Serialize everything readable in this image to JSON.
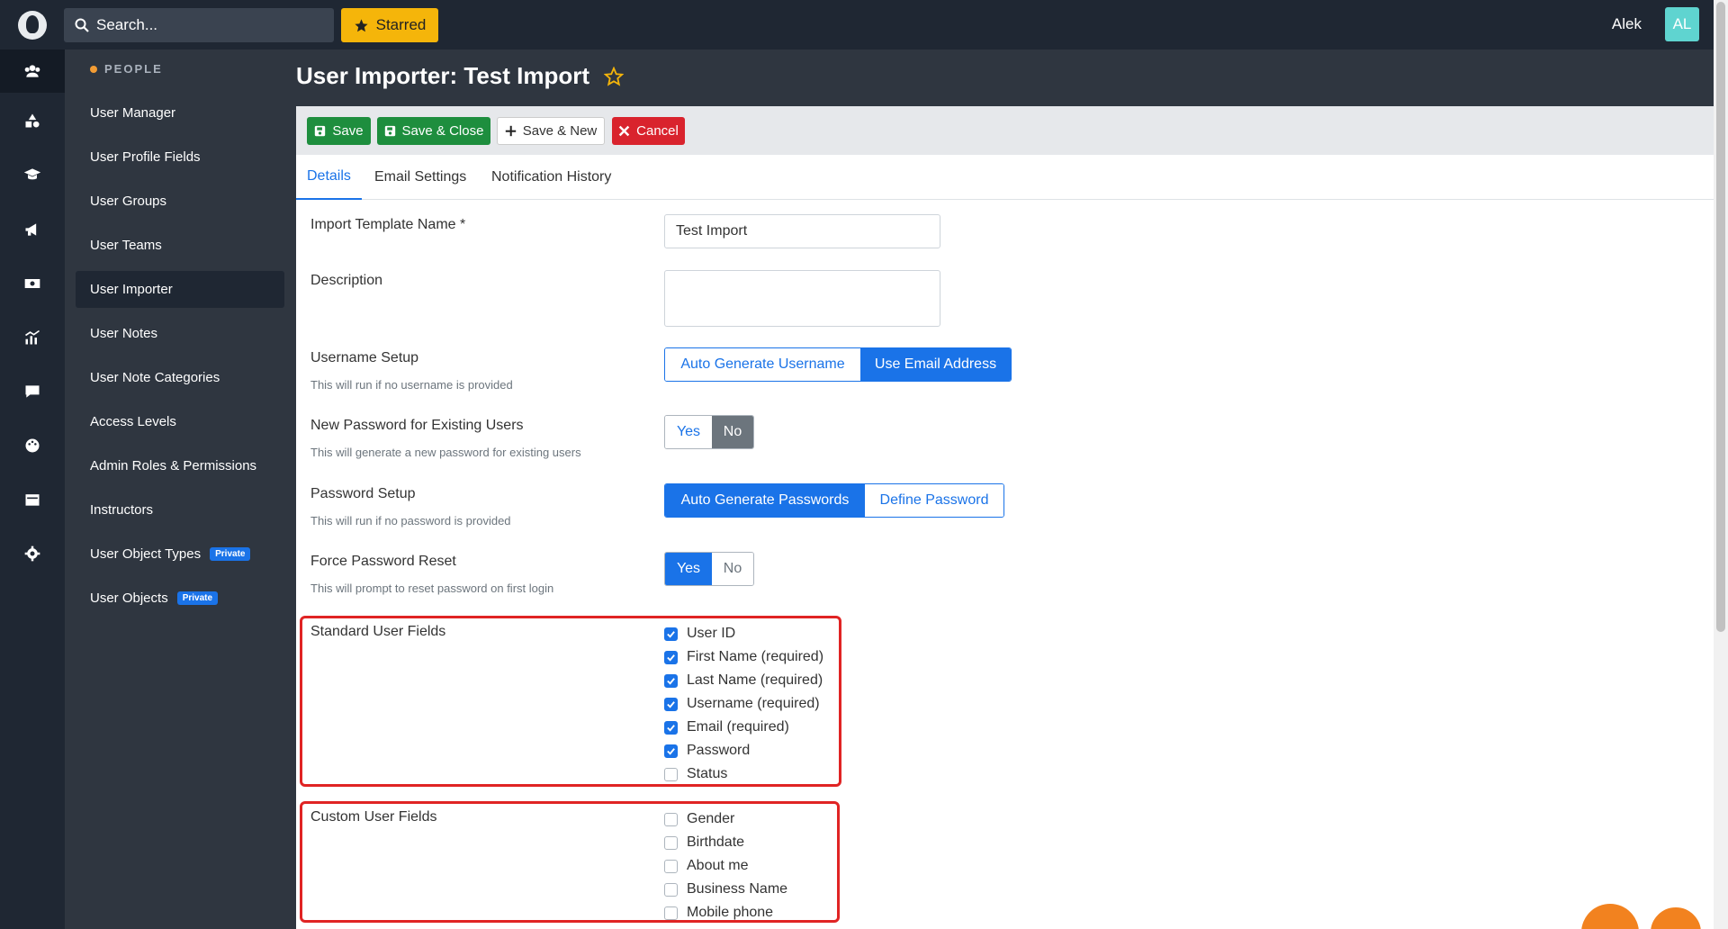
{
  "header": {
    "search_placeholder": "Search...",
    "starred_label": "Starred",
    "user_name": "Alek",
    "avatar_initials": "AL"
  },
  "sidebar": {
    "section": "PEOPLE",
    "items": [
      {
        "label": "User Manager"
      },
      {
        "label": "User Profile Fields"
      },
      {
        "label": "User Groups"
      },
      {
        "label": "User Teams"
      },
      {
        "label": "User Importer"
      },
      {
        "label": "User Notes"
      },
      {
        "label": "User Note Categories"
      },
      {
        "label": "Access Levels"
      },
      {
        "label": "Admin Roles & Permissions"
      },
      {
        "label": "Instructors"
      },
      {
        "label": "User Object Types",
        "badge": "Private"
      },
      {
        "label": "User Objects",
        "badge": "Private"
      }
    ]
  },
  "page": {
    "title": "User Importer: Test Import"
  },
  "toolbar": {
    "save": "Save",
    "save_close": "Save & Close",
    "save_new": "Save & New",
    "cancel": "Cancel"
  },
  "tabs": [
    "Details",
    "Email Settings",
    "Notification History"
  ],
  "form": {
    "template_name_label": "Import Template Name *",
    "template_name_value": "Test Import",
    "description_label": "Description",
    "username_setup_label": "Username Setup",
    "username_setup_help": "This will run if no username is provided",
    "username_options": [
      "Auto Generate Username",
      "Use Email Address"
    ],
    "new_password_label": "New Password for Existing Users",
    "new_password_help": "This will generate a new password for existing users",
    "new_password_options": [
      "Yes",
      "No"
    ],
    "password_setup_label": "Password Setup",
    "password_setup_help": "This will run if no password is provided",
    "password_setup_options": [
      "Auto Generate Passwords",
      "Define Password"
    ],
    "force_reset_label": "Force Password Reset",
    "force_reset_help": "This will prompt to reset password on first login",
    "force_reset_options": [
      "Yes",
      "No"
    ],
    "standard_fields_label": "Standard User Fields",
    "standard_fields": [
      {
        "label": "User ID",
        "checked": true
      },
      {
        "label": "First Name (required)",
        "checked": true
      },
      {
        "label": "Last Name (required)",
        "checked": true
      },
      {
        "label": "Username (required)",
        "checked": true
      },
      {
        "label": "Email (required)",
        "checked": true
      },
      {
        "label": "Password",
        "checked": true
      },
      {
        "label": "Status",
        "checked": false
      }
    ],
    "custom_fields_label": "Custom User Fields",
    "custom_fields": [
      {
        "label": "Gender",
        "checked": false
      },
      {
        "label": "Birthdate",
        "checked": false
      },
      {
        "label": "About me",
        "checked": false
      },
      {
        "label": "Business Name",
        "checked": false
      },
      {
        "label": "Mobile phone",
        "checked": false
      }
    ]
  },
  "colors": {
    "primary": "#1a73e8",
    "success": "#1e8e3e",
    "danger": "#d9232d",
    "warning": "#f5b50a",
    "highlight": "#e02424"
  }
}
